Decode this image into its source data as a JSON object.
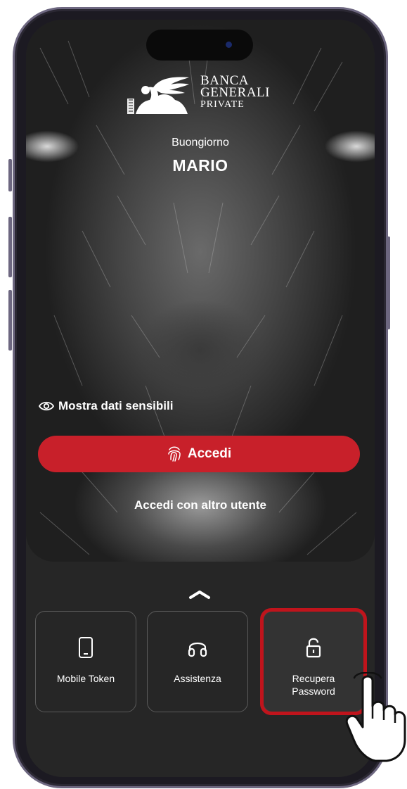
{
  "brand": {
    "line1": "BANCA",
    "line2": "GENERALI",
    "line3": "PRIVATE"
  },
  "greeting": "Buongiorno",
  "username": "MARIO",
  "sensitive_toggle": {
    "label": "Mostra dati sensibili",
    "icon": "eye-icon"
  },
  "login_button": {
    "label": "Accedi",
    "icon": "fingerprint-icon"
  },
  "other_user_link": "Accedi con altro utente",
  "quick_actions": [
    {
      "label": "Mobile Token",
      "icon": "smartphone-icon"
    },
    {
      "label": "Assistenza",
      "icon": "headphones-icon"
    },
    {
      "label_line1": "Recupera",
      "label_line2": "Password",
      "icon": "unlock-icon",
      "highlighted": true
    }
  ],
  "colors": {
    "accent": "#c8202a",
    "highlight": "#c0141c",
    "background": "#262626"
  }
}
